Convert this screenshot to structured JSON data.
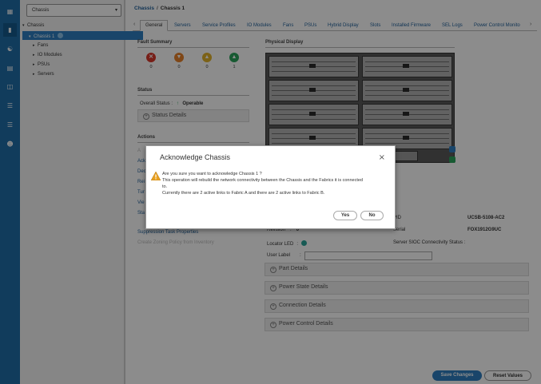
{
  "nav": {
    "scope_value": "Chassis",
    "tree": {
      "root": "Chassis",
      "selected": "Chassis 1",
      "children": [
        "Fans",
        "IO Modules",
        "PSUs",
        "Servers"
      ]
    }
  },
  "header": {
    "breadcrumb_root": "Chassis",
    "breadcrumb_sep": "/",
    "breadcrumb_current": "Chassis 1"
  },
  "tabs": [
    "General",
    "Servers",
    "Service Profiles",
    "IO Modules",
    "Fans",
    "PSUs",
    "Hybrid Display",
    "Slots",
    "Installed Firmware",
    "SEL Logs",
    "Power Control Monito"
  ],
  "left": {
    "fault_summary_title": "Fault Summary",
    "fault_counts": [
      "0",
      "0",
      "0",
      "1"
    ],
    "status_title": "Status",
    "overall_status_label": "Overall Status :",
    "overall_status_value": "Operable",
    "status_details_label": "Status Details",
    "actions_title": "Actions",
    "actions_partial": [
      "Ack",
      "Dec",
      "Rei",
      "Tur",
      "Vie",
      "Sta"
    ],
    "suppression": "Suppression Task Properties",
    "create_zoning": "Create Zoning Policy from Inventory"
  },
  "right": {
    "physical_display_title": "Physical Display",
    "pid_label": "PID",
    "pid_value": "UCSB-5108-AC2",
    "revision_label": "Revision",
    "revision_value": "0",
    "serial_label": "Serial",
    "serial_value": "FOX1912G9UC",
    "locator_led_label": "Locator LED",
    "sioc_label": "Server SIOC Connectivity Status :",
    "user_label_label": "User Label",
    "user_label_value": "",
    "part_details": "Part Details",
    "power_state_details": "Power State Details",
    "connection_details": "Connection Details",
    "power_control_details": "Power Control Details"
  },
  "footer": {
    "save": "Save Changes",
    "reset": "Reset Values"
  },
  "modal": {
    "title": "Acknowledge Chassis",
    "close": "×",
    "line1": "Are you sure you want to acknowledge Chassis 1 ?",
    "line2": "This operation will rebuild the network connectivity between the Chassis and the Fabrics it is connected",
    "line3": "to.",
    "line4": "Currently there are 2 active links to Fabric A and there are 2 active links to Fabric B.",
    "yes": "Yes",
    "no": "No"
  },
  "colors": {
    "iconbar": "#1f6da8",
    "link": "#1f5f99",
    "primary_button": "#2e7fc1",
    "fault_critical": "#d9382b",
    "fault_major": "#e8822a",
    "fault_minor": "#e2b22b",
    "fault_info": "#2aa55c"
  }
}
